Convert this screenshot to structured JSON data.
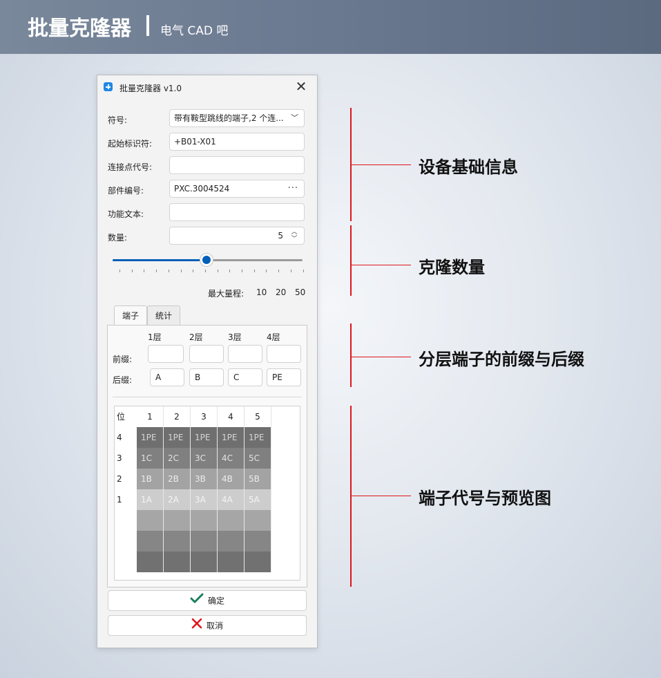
{
  "header": {
    "title": "批量克隆器",
    "subtitle": "电气 CAD 吧"
  },
  "window": {
    "title": "批量克隆器 v1.0",
    "close_icon": "close-icon"
  },
  "form": {
    "symbol": {
      "label": "符号:",
      "value": "带有鞍型跳线的端子,2 个连..."
    },
    "start_id": {
      "label": "起始标识符:",
      "value": "+B01-X01"
    },
    "connection_code": {
      "label": "连接点代号:",
      "value": ""
    },
    "part_number": {
      "label": "部件编号:",
      "value": "PXC.3004524",
      "more": "···"
    },
    "function_text": {
      "label": "功能文本:",
      "value": ""
    },
    "quantity": {
      "label": "数量:",
      "value": "5"
    }
  },
  "slider": {
    "value": 5,
    "min": 0,
    "max": 10
  },
  "max_range": {
    "label": "最大量程:",
    "options": [
      "10",
      "20",
      "50"
    ]
  },
  "tabs": [
    {
      "label": "端子",
      "active": true
    },
    {
      "label": "统计",
      "active": false
    }
  ],
  "layers": {
    "headers": [
      "1层",
      "2层",
      "3层",
      "4层"
    ],
    "prefix_label": "前缀:",
    "suffix_label": "后缀:",
    "prefix": [
      "",
      "",
      "",
      ""
    ],
    "suffix": [
      "A",
      "B",
      "C",
      "PE"
    ]
  },
  "grid": {
    "corner": "位",
    "columns": [
      "1",
      "2",
      "3",
      "4",
      "5"
    ],
    "rows": [
      {
        "pos": "4",
        "cells": [
          "1PE",
          "1PE",
          "1PE",
          "1PE",
          "1PE"
        ]
      },
      {
        "pos": "3",
        "cells": [
          "1C",
          "2C",
          "3C",
          "4C",
          "5C"
        ]
      },
      {
        "pos": "2",
        "cells": [
          "1B",
          "2B",
          "3B",
          "4B",
          "5B"
        ]
      },
      {
        "pos": "1",
        "cells": [
          "1A",
          "2A",
          "3A",
          "4A",
          "5A"
        ]
      }
    ]
  },
  "buttons": {
    "ok": "确定",
    "cancel": "取消"
  },
  "callouts": [
    "设备基础信息",
    "克隆数量",
    "分层端子的前缀与后缀",
    "端子代号与预览图"
  ],
  "colors": {
    "accent": "#005fb8",
    "callout_line": "#e0141b",
    "ok_icon": "#1a7f5a",
    "cancel_icon": "#e0141b"
  }
}
